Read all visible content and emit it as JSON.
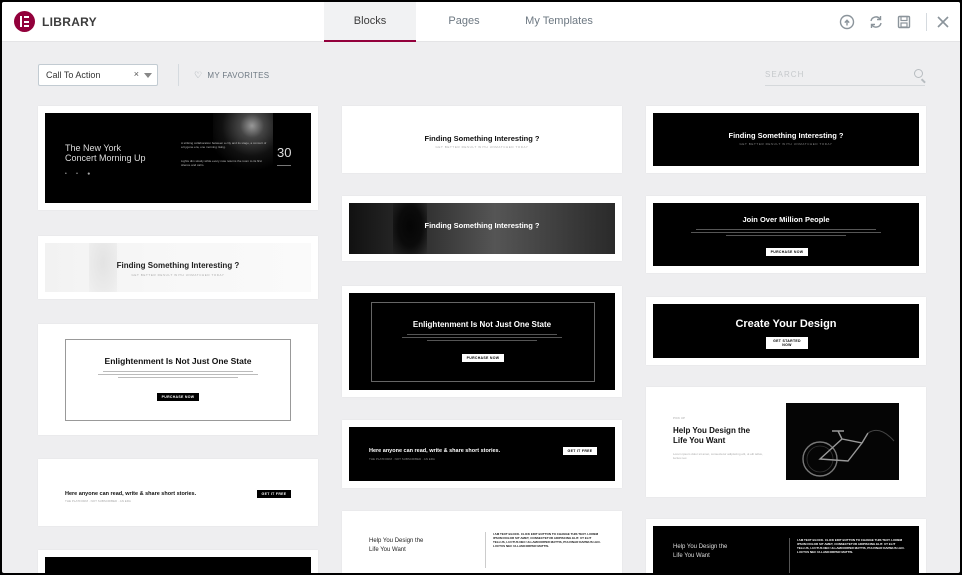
{
  "header": {
    "title": "LIBRARY",
    "tabs": [
      {
        "label": "Blocks",
        "active": true
      },
      {
        "label": "Pages",
        "active": false
      },
      {
        "label": "My Templates",
        "active": false
      }
    ],
    "icons": [
      "info-icon",
      "sync-icon",
      "save-icon",
      "close-icon"
    ]
  },
  "filter": {
    "category_value": "Call To Action",
    "clear_glyph": "×",
    "favorites_label": "MY FAVORITES",
    "search_placeholder": "SEARCH"
  },
  "colors": {
    "accent": "#93003c",
    "background": "#eeeef0"
  },
  "cards": {
    "c1": {
      "title": "The New York\nConcert Morning Up",
      "date": "30"
    },
    "c2": {
      "title": "Finding Something Interesting ?"
    },
    "c3": {
      "title": "Enlightenment Is Not Just One State",
      "button": "PURCHASE NOW"
    },
    "c4": {
      "title": "Here anyone can read, write & share short stories.",
      "button": "GET IT FREE"
    },
    "c5": {
      "title": "Finding Something Interesting ?"
    },
    "c6": {
      "title": "Finding Something Interesting ?"
    },
    "c7": {
      "title": "Enlightenment Is Not Just One State",
      "button": "PURCHASE NOW"
    },
    "c8": {
      "title": "Here anyone can read, write & share short stories.",
      "button": "GET IT FREE"
    },
    "c9": {
      "title": "Help You Design the\nLife You Want"
    },
    "c10": {
      "title": "Finding Something Interesting ?"
    },
    "c11": {
      "title": "Join Over Million People",
      "button": "PURCHASE NOW"
    },
    "c12": {
      "title": "Create Your Design",
      "button": "GET STARTED NOW"
    },
    "c13": {
      "title": "Help You Design the\nLife You Want"
    },
    "c14": {
      "title": "Help You Design the\nLife You Want"
    }
  }
}
